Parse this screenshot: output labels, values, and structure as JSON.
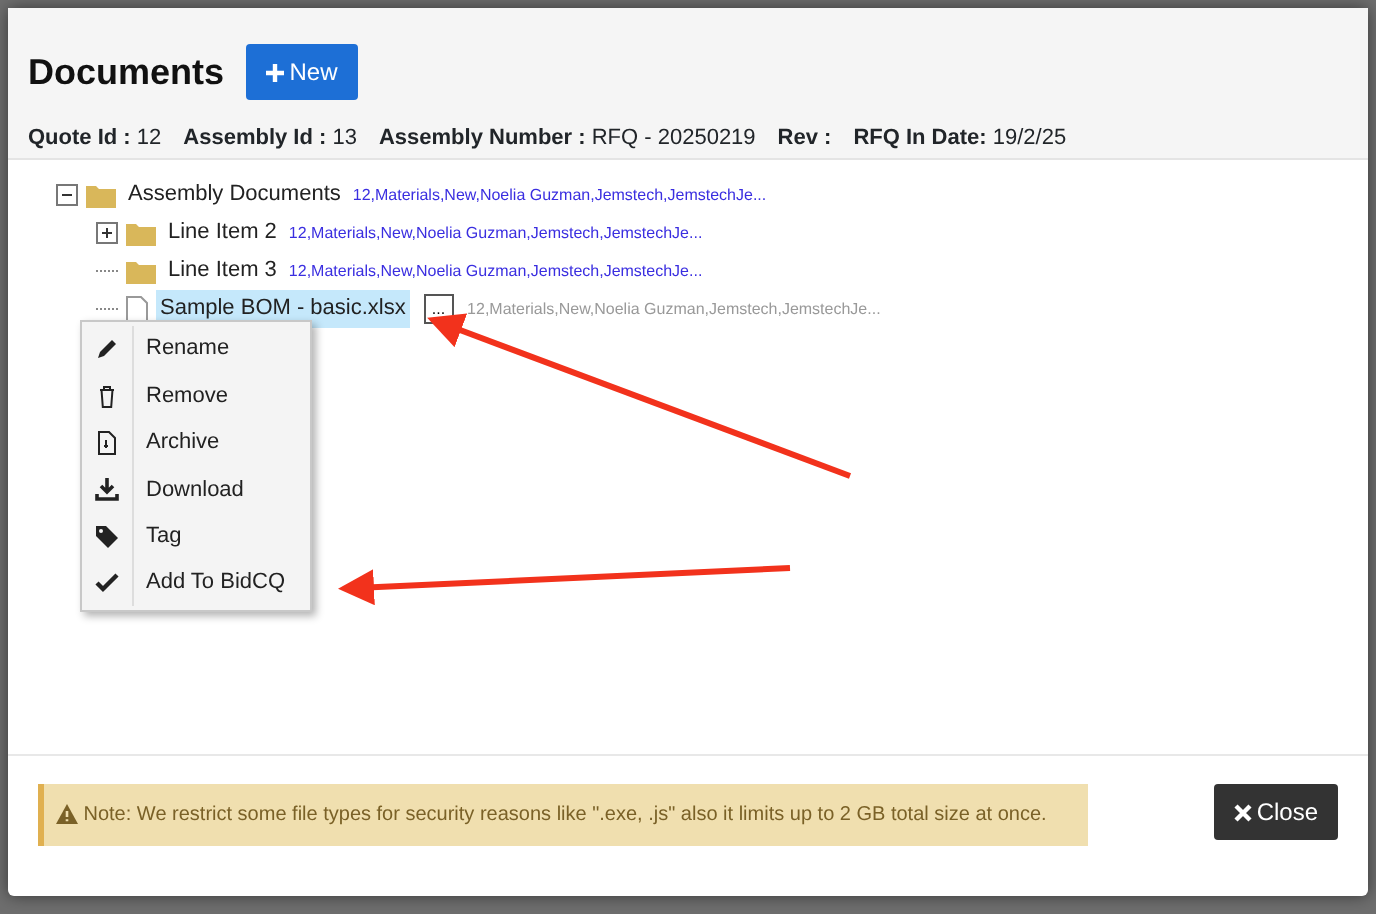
{
  "header": {
    "title": "Documents",
    "new_button": "New"
  },
  "info": [
    {
      "label": "Quote Id :",
      "value": "12"
    },
    {
      "label": "Assembly Id :",
      "value": "13"
    },
    {
      "label": "Assembly Number :",
      "value": "RFQ - 20250219"
    },
    {
      "label": "Rev :"
    },
    {
      "label": "RFQ In Date:",
      "value": "19/2/25"
    }
  ],
  "tree": [
    {
      "kind": "folder",
      "label": "Assembly Documents",
      "meta": "12,Materials,New,Noelia Guzman,Jemstech,JemstechJe...",
      "expanded": true,
      "selected": false,
      "children": [
        {
          "kind": "folder",
          "label": "Line Item 2",
          "meta": "12,Materials,New,Noelia Guzman,Jemstech,JemstechJe...",
          "expanded": false,
          "selected": false
        },
        {
          "kind": "folder",
          "label": "Line Item 3",
          "meta": "12,Materials,New,Noelia Guzman,Jemstech,JemstechJe...",
          "selected": false
        },
        {
          "kind": "file",
          "label": "Sample BOM - basic.xlsx",
          "meta": "12,Materials,New,Noelia Guzman,Jemstech,JemstechJe...",
          "selected": true,
          "more_button": "..."
        }
      ]
    }
  ],
  "context_menu": [
    "Rename",
    "Remove",
    "Archive",
    "Download",
    "Tag",
    "Add To BidCQ"
  ],
  "footer": {
    "note": "Note: We restrict some file types for security reasons like \".exe, .js\" also it limits up to 2 GB total size at once.",
    "close_button": "Close"
  }
}
